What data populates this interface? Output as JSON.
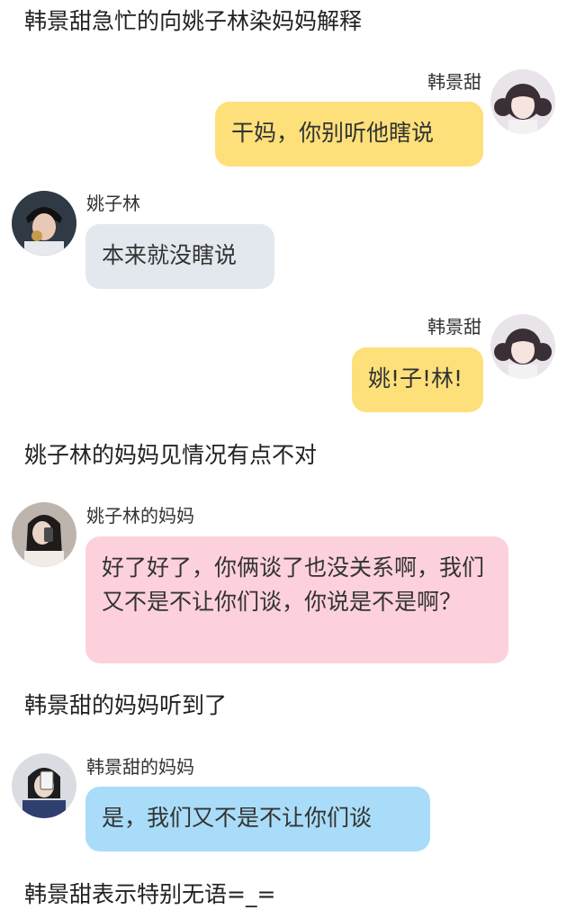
{
  "narration": {
    "line1": "韩景甜急忙的向姚子林染妈妈解释",
    "line2": "姚子林的妈妈见情况有点不对",
    "line3": "韩景甜的妈妈听到了",
    "line4": "韩景甜表示特别无语=_="
  },
  "messages": [
    {
      "sender": "韩景甜",
      "text": "干妈，你别听他瞎说",
      "side": "right",
      "avatar": "girl-pigtails-avatar",
      "color": "#fde07a"
    },
    {
      "sender": "姚子林",
      "text": "本来就没瞎说",
      "side": "left",
      "avatar": "boy-avatar",
      "color": "#e3e8ef"
    },
    {
      "sender": "韩景甜",
      "text": "姚!子!林!",
      "side": "right",
      "avatar": "girl-pigtails-avatar",
      "color": "#fde07a"
    },
    {
      "sender": "姚子林的妈妈",
      "text": "好了好了，你俩谈了也没关系啊，我们又不是不让你们谈，你说是不是啊？",
      "side": "left",
      "avatar": "woman-phone-avatar",
      "color": "#fdd1dc"
    },
    {
      "sender": "韩景甜的妈妈",
      "text": "是，我们又不是不让你们谈",
      "side": "left",
      "avatar": "woman-selfie-avatar",
      "color": "#a9dcf8"
    }
  ]
}
